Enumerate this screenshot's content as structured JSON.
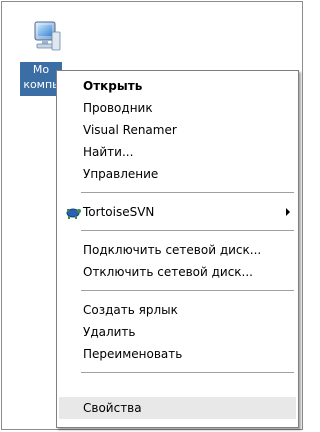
{
  "desktop_icon": {
    "label_line1": "Мо",
    "label_line2": "компь"
  },
  "context_menu": {
    "open": "Открыть",
    "explorer": "Проводник",
    "visual_renamer": "Visual Renamer",
    "find": "Найти...",
    "manage": "Управление",
    "tortoisesvn": "TortoiseSVN",
    "map_drive": "Подключить сетевой диск...",
    "disconnect_drive": "Отключить сетевой диск...",
    "create_shortcut": "Создать ярлык",
    "delete": "Удалить",
    "rename": "Переименовать",
    "properties": "Свойства"
  },
  "colors": {
    "selection_label_bg": "#3a6ea5",
    "hover_bg": "#e8e8e8"
  },
  "icons": {
    "desktop_icon": "computer-icon",
    "svn_icon": "tortoise-icon",
    "submenu_arrow": "chevron-right-icon"
  }
}
